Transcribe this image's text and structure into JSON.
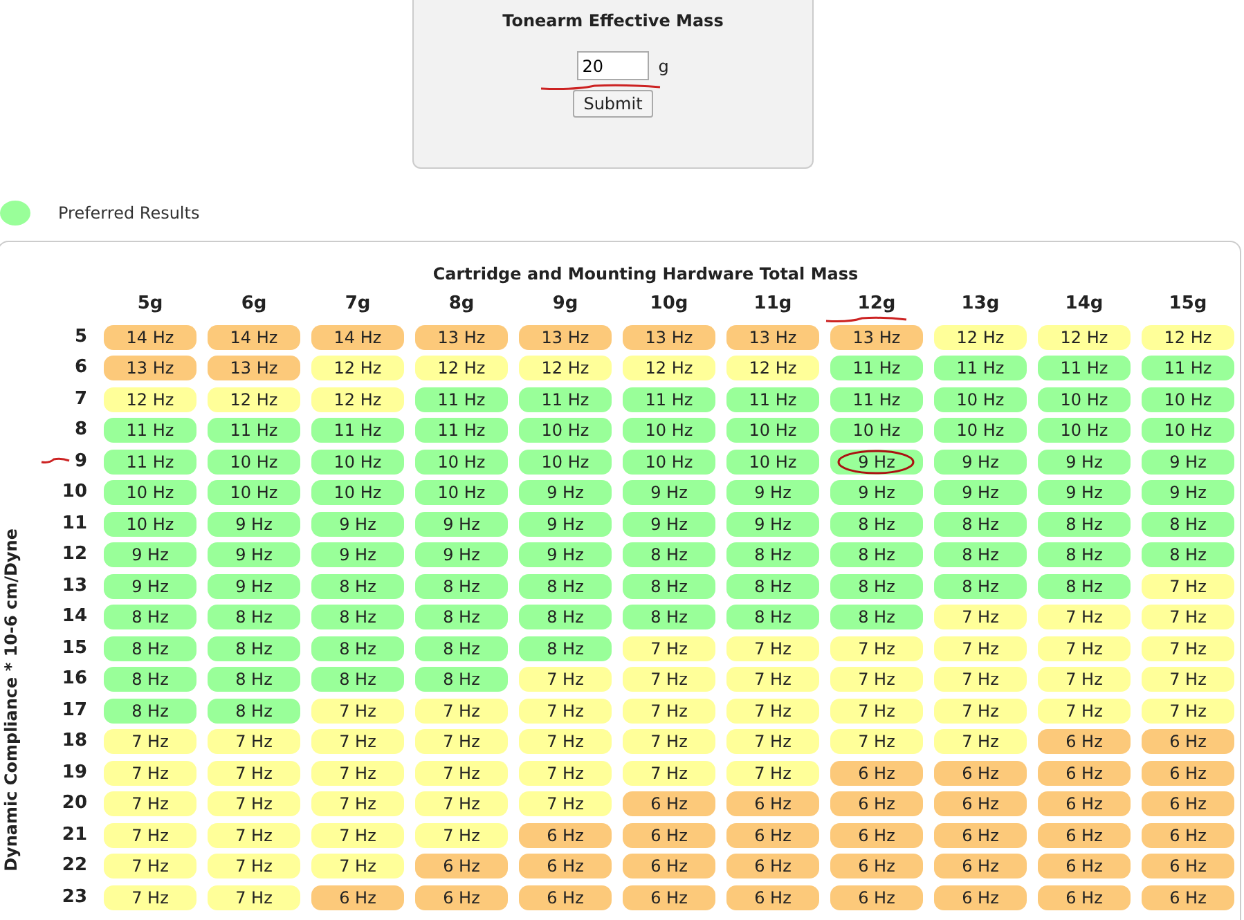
{
  "mass_form": {
    "title": "Tonearm Effective Mass",
    "value": "20",
    "underlined": true,
    "unit": "g",
    "submit": "Submit"
  },
  "legend": {
    "label": "Preferred Results",
    "color": "#99ff99"
  },
  "table": {
    "title": "Cartridge and Mounting Hardware Total Mass",
    "y_axis_label": "Dynamic Compliance * 10-6 cm/Dyne",
    "columns": [
      {
        "label": "5g",
        "underlined": false
      },
      {
        "label": "6g",
        "underlined": false
      },
      {
        "label": "7g",
        "underlined": false
      },
      {
        "label": "8g",
        "underlined": false
      },
      {
        "label": "9g",
        "underlined": false
      },
      {
        "label": "10g",
        "underlined": false
      },
      {
        "label": "11g",
        "underlined": false
      },
      {
        "label": "12g",
        "underlined": true
      },
      {
        "label": "13g",
        "underlined": false
      },
      {
        "label": "14g",
        "underlined": false
      },
      {
        "label": "15g",
        "underlined": false
      }
    ],
    "rows": [
      {
        "label": "5",
        "underlined": false,
        "cells": [
          {
            "text": "14 Hz",
            "color": "#fcc97a",
            "circled": false
          },
          {
            "text": "14 Hz",
            "color": "#fcc97a",
            "circled": false
          },
          {
            "text": "14 Hz",
            "color": "#fcc97a",
            "circled": false
          },
          {
            "text": "13 Hz",
            "color": "#fcc97a",
            "circled": false
          },
          {
            "text": "13 Hz",
            "color": "#fcc97a",
            "circled": false
          },
          {
            "text": "13 Hz",
            "color": "#fcc97a",
            "circled": false
          },
          {
            "text": "13 Hz",
            "color": "#fcc97a",
            "circled": false
          },
          {
            "text": "13 Hz",
            "color": "#fcc97a",
            "circled": false
          },
          {
            "text": "12 Hz",
            "color": "#ffff99",
            "circled": false
          },
          {
            "text": "12 Hz",
            "color": "#ffff99",
            "circled": false
          },
          {
            "text": "12 Hz",
            "color": "#ffff99",
            "circled": false
          }
        ]
      },
      {
        "label": "6",
        "underlined": false,
        "cells": [
          {
            "text": "13 Hz",
            "color": "#fcc97a",
            "circled": false
          },
          {
            "text": "13 Hz",
            "color": "#fcc97a",
            "circled": false
          },
          {
            "text": "12 Hz",
            "color": "#ffff99",
            "circled": false
          },
          {
            "text": "12 Hz",
            "color": "#ffff99",
            "circled": false
          },
          {
            "text": "12 Hz",
            "color": "#ffff99",
            "circled": false
          },
          {
            "text": "12 Hz",
            "color": "#ffff99",
            "circled": false
          },
          {
            "text": "12 Hz",
            "color": "#ffff99",
            "circled": false
          },
          {
            "text": "11 Hz",
            "color": "#99ff99",
            "circled": false
          },
          {
            "text": "11 Hz",
            "color": "#99ff99",
            "circled": false
          },
          {
            "text": "11 Hz",
            "color": "#99ff99",
            "circled": false
          },
          {
            "text": "11 Hz",
            "color": "#99ff99",
            "circled": false
          }
        ]
      },
      {
        "label": "7",
        "underlined": false,
        "cells": [
          {
            "text": "12 Hz",
            "color": "#ffff99",
            "circled": false
          },
          {
            "text": "12 Hz",
            "color": "#ffff99",
            "circled": false
          },
          {
            "text": "12 Hz",
            "color": "#ffff99",
            "circled": false
          },
          {
            "text": "11 Hz",
            "color": "#99ff99",
            "circled": false
          },
          {
            "text": "11 Hz",
            "color": "#99ff99",
            "circled": false
          },
          {
            "text": "11 Hz",
            "color": "#99ff99",
            "circled": false
          },
          {
            "text": "11 Hz",
            "color": "#99ff99",
            "circled": false
          },
          {
            "text": "11 Hz",
            "color": "#99ff99",
            "circled": false
          },
          {
            "text": "10 Hz",
            "color": "#99ff99",
            "circled": false
          },
          {
            "text": "10 Hz",
            "color": "#99ff99",
            "circled": false
          },
          {
            "text": "10 Hz",
            "color": "#99ff99",
            "circled": false
          }
        ]
      },
      {
        "label": "8",
        "underlined": false,
        "cells": [
          {
            "text": "11 Hz",
            "color": "#99ff99",
            "circled": false
          },
          {
            "text": "11 Hz",
            "color": "#99ff99",
            "circled": false
          },
          {
            "text": "11 Hz",
            "color": "#99ff99",
            "circled": false
          },
          {
            "text": "11 Hz",
            "color": "#99ff99",
            "circled": false
          },
          {
            "text": "10 Hz",
            "color": "#99ff99",
            "circled": false
          },
          {
            "text": "10 Hz",
            "color": "#99ff99",
            "circled": false
          },
          {
            "text": "10 Hz",
            "color": "#99ff99",
            "circled": false
          },
          {
            "text": "10 Hz",
            "color": "#99ff99",
            "circled": false
          },
          {
            "text": "10 Hz",
            "color": "#99ff99",
            "circled": false
          },
          {
            "text": "10 Hz",
            "color": "#99ff99",
            "circled": false
          },
          {
            "text": "10 Hz",
            "color": "#99ff99",
            "circled": false
          }
        ]
      },
      {
        "label": "9",
        "underlined": true,
        "cells": [
          {
            "text": "11 Hz",
            "color": "#99ff99",
            "circled": false
          },
          {
            "text": "10 Hz",
            "color": "#99ff99",
            "circled": false
          },
          {
            "text": "10 Hz",
            "color": "#99ff99",
            "circled": false
          },
          {
            "text": "10 Hz",
            "color": "#99ff99",
            "circled": false
          },
          {
            "text": "10 Hz",
            "color": "#99ff99",
            "circled": false
          },
          {
            "text": "10 Hz",
            "color": "#99ff99",
            "circled": false
          },
          {
            "text": "10 Hz",
            "color": "#99ff99",
            "circled": false
          },
          {
            "text": "9 Hz",
            "color": "#99ff99",
            "circled": true
          },
          {
            "text": "9 Hz",
            "color": "#99ff99",
            "circled": false
          },
          {
            "text": "9 Hz",
            "color": "#99ff99",
            "circled": false
          },
          {
            "text": "9 Hz",
            "color": "#99ff99",
            "circled": false
          }
        ]
      },
      {
        "label": "10",
        "underlined": false,
        "cells": [
          {
            "text": "10 Hz",
            "color": "#99ff99",
            "circled": false
          },
          {
            "text": "10 Hz",
            "color": "#99ff99",
            "circled": false
          },
          {
            "text": "10 Hz",
            "color": "#99ff99",
            "circled": false
          },
          {
            "text": "10 Hz",
            "color": "#99ff99",
            "circled": false
          },
          {
            "text": "9 Hz",
            "color": "#99ff99",
            "circled": false
          },
          {
            "text": "9 Hz",
            "color": "#99ff99",
            "circled": false
          },
          {
            "text": "9 Hz",
            "color": "#99ff99",
            "circled": false
          },
          {
            "text": "9 Hz",
            "color": "#99ff99",
            "circled": false
          },
          {
            "text": "9 Hz",
            "color": "#99ff99",
            "circled": false
          },
          {
            "text": "9 Hz",
            "color": "#99ff99",
            "circled": false
          },
          {
            "text": "9 Hz",
            "color": "#99ff99",
            "circled": false
          }
        ]
      },
      {
        "label": "11",
        "underlined": false,
        "cells": [
          {
            "text": "10 Hz",
            "color": "#99ff99",
            "circled": false
          },
          {
            "text": "9 Hz",
            "color": "#99ff99",
            "circled": false
          },
          {
            "text": "9 Hz",
            "color": "#99ff99",
            "circled": false
          },
          {
            "text": "9 Hz",
            "color": "#99ff99",
            "circled": false
          },
          {
            "text": "9 Hz",
            "color": "#99ff99",
            "circled": false
          },
          {
            "text": "9 Hz",
            "color": "#99ff99",
            "circled": false
          },
          {
            "text": "9 Hz",
            "color": "#99ff99",
            "circled": false
          },
          {
            "text": "8 Hz",
            "color": "#99ff99",
            "circled": false
          },
          {
            "text": "8 Hz",
            "color": "#99ff99",
            "circled": false
          },
          {
            "text": "8 Hz",
            "color": "#99ff99",
            "circled": false
          },
          {
            "text": "8 Hz",
            "color": "#99ff99",
            "circled": false
          }
        ]
      },
      {
        "label": "12",
        "underlined": false,
        "cells": [
          {
            "text": "9 Hz",
            "color": "#99ff99",
            "circled": false
          },
          {
            "text": "9 Hz",
            "color": "#99ff99",
            "circled": false
          },
          {
            "text": "9 Hz",
            "color": "#99ff99",
            "circled": false
          },
          {
            "text": "9 Hz",
            "color": "#99ff99",
            "circled": false
          },
          {
            "text": "9 Hz",
            "color": "#99ff99",
            "circled": false
          },
          {
            "text": "8 Hz",
            "color": "#99ff99",
            "circled": false
          },
          {
            "text": "8 Hz",
            "color": "#99ff99",
            "circled": false
          },
          {
            "text": "8 Hz",
            "color": "#99ff99",
            "circled": false
          },
          {
            "text": "8 Hz",
            "color": "#99ff99",
            "circled": false
          },
          {
            "text": "8 Hz",
            "color": "#99ff99",
            "circled": false
          },
          {
            "text": "8 Hz",
            "color": "#99ff99",
            "circled": false
          }
        ]
      },
      {
        "label": "13",
        "underlined": false,
        "cells": [
          {
            "text": "9 Hz",
            "color": "#99ff99",
            "circled": false
          },
          {
            "text": "9 Hz",
            "color": "#99ff99",
            "circled": false
          },
          {
            "text": "8 Hz",
            "color": "#99ff99",
            "circled": false
          },
          {
            "text": "8 Hz",
            "color": "#99ff99",
            "circled": false
          },
          {
            "text": "8 Hz",
            "color": "#99ff99",
            "circled": false
          },
          {
            "text": "8 Hz",
            "color": "#99ff99",
            "circled": false
          },
          {
            "text": "8 Hz",
            "color": "#99ff99",
            "circled": false
          },
          {
            "text": "8 Hz",
            "color": "#99ff99",
            "circled": false
          },
          {
            "text": "8 Hz",
            "color": "#99ff99",
            "circled": false
          },
          {
            "text": "8 Hz",
            "color": "#99ff99",
            "circled": false
          },
          {
            "text": "7 Hz",
            "color": "#ffff99",
            "circled": false
          }
        ]
      },
      {
        "label": "14",
        "underlined": false,
        "cells": [
          {
            "text": "8 Hz",
            "color": "#99ff99",
            "circled": false
          },
          {
            "text": "8 Hz",
            "color": "#99ff99",
            "circled": false
          },
          {
            "text": "8 Hz",
            "color": "#99ff99",
            "circled": false
          },
          {
            "text": "8 Hz",
            "color": "#99ff99",
            "circled": false
          },
          {
            "text": "8 Hz",
            "color": "#99ff99",
            "circled": false
          },
          {
            "text": "8 Hz",
            "color": "#99ff99",
            "circled": false
          },
          {
            "text": "8 Hz",
            "color": "#99ff99",
            "circled": false
          },
          {
            "text": "8 Hz",
            "color": "#99ff99",
            "circled": false
          },
          {
            "text": "7 Hz",
            "color": "#ffff99",
            "circled": false
          },
          {
            "text": "7 Hz",
            "color": "#ffff99",
            "circled": false
          },
          {
            "text": "7 Hz",
            "color": "#ffff99",
            "circled": false
          }
        ]
      },
      {
        "label": "15",
        "underlined": false,
        "cells": [
          {
            "text": "8 Hz",
            "color": "#99ff99",
            "circled": false
          },
          {
            "text": "8 Hz",
            "color": "#99ff99",
            "circled": false
          },
          {
            "text": "8 Hz",
            "color": "#99ff99",
            "circled": false
          },
          {
            "text": "8 Hz",
            "color": "#99ff99",
            "circled": false
          },
          {
            "text": "8 Hz",
            "color": "#99ff99",
            "circled": false
          },
          {
            "text": "7 Hz",
            "color": "#ffff99",
            "circled": false
          },
          {
            "text": "7 Hz",
            "color": "#ffff99",
            "circled": false
          },
          {
            "text": "7 Hz",
            "color": "#ffff99",
            "circled": false
          },
          {
            "text": "7 Hz",
            "color": "#ffff99",
            "circled": false
          },
          {
            "text": "7 Hz",
            "color": "#ffff99",
            "circled": false
          },
          {
            "text": "7 Hz",
            "color": "#ffff99",
            "circled": false
          }
        ]
      },
      {
        "label": "16",
        "underlined": false,
        "cells": [
          {
            "text": "8 Hz",
            "color": "#99ff99",
            "circled": false
          },
          {
            "text": "8 Hz",
            "color": "#99ff99",
            "circled": false
          },
          {
            "text": "8 Hz",
            "color": "#99ff99",
            "circled": false
          },
          {
            "text": "8 Hz",
            "color": "#99ff99",
            "circled": false
          },
          {
            "text": "7 Hz",
            "color": "#ffff99",
            "circled": false
          },
          {
            "text": "7 Hz",
            "color": "#ffff99",
            "circled": false
          },
          {
            "text": "7 Hz",
            "color": "#ffff99",
            "circled": false
          },
          {
            "text": "7 Hz",
            "color": "#ffff99",
            "circled": false
          },
          {
            "text": "7 Hz",
            "color": "#ffff99",
            "circled": false
          },
          {
            "text": "7 Hz",
            "color": "#ffff99",
            "circled": false
          },
          {
            "text": "7 Hz",
            "color": "#ffff99",
            "circled": false
          }
        ]
      },
      {
        "label": "17",
        "underlined": false,
        "cells": [
          {
            "text": "8 Hz",
            "color": "#99ff99",
            "circled": false
          },
          {
            "text": "8 Hz",
            "color": "#99ff99",
            "circled": false
          },
          {
            "text": "7 Hz",
            "color": "#ffff99",
            "circled": false
          },
          {
            "text": "7 Hz",
            "color": "#ffff99",
            "circled": false
          },
          {
            "text": "7 Hz",
            "color": "#ffff99",
            "circled": false
          },
          {
            "text": "7 Hz",
            "color": "#ffff99",
            "circled": false
          },
          {
            "text": "7 Hz",
            "color": "#ffff99",
            "circled": false
          },
          {
            "text": "7 Hz",
            "color": "#ffff99",
            "circled": false
          },
          {
            "text": "7 Hz",
            "color": "#ffff99",
            "circled": false
          },
          {
            "text": "7 Hz",
            "color": "#ffff99",
            "circled": false
          },
          {
            "text": "7 Hz",
            "color": "#ffff99",
            "circled": false
          }
        ]
      },
      {
        "label": "18",
        "underlined": false,
        "cells": [
          {
            "text": "7 Hz",
            "color": "#ffff99",
            "circled": false
          },
          {
            "text": "7 Hz",
            "color": "#ffff99",
            "circled": false
          },
          {
            "text": "7 Hz",
            "color": "#ffff99",
            "circled": false
          },
          {
            "text": "7 Hz",
            "color": "#ffff99",
            "circled": false
          },
          {
            "text": "7 Hz",
            "color": "#ffff99",
            "circled": false
          },
          {
            "text": "7 Hz",
            "color": "#ffff99",
            "circled": false
          },
          {
            "text": "7 Hz",
            "color": "#ffff99",
            "circled": false
          },
          {
            "text": "7 Hz",
            "color": "#ffff99",
            "circled": false
          },
          {
            "text": "7 Hz",
            "color": "#ffff99",
            "circled": false
          },
          {
            "text": "6 Hz",
            "color": "#fcc97a",
            "circled": false
          },
          {
            "text": "6 Hz",
            "color": "#fcc97a",
            "circled": false
          }
        ]
      },
      {
        "label": "19",
        "underlined": false,
        "cells": [
          {
            "text": "7 Hz",
            "color": "#ffff99",
            "circled": false
          },
          {
            "text": "7 Hz",
            "color": "#ffff99",
            "circled": false
          },
          {
            "text": "7 Hz",
            "color": "#ffff99",
            "circled": false
          },
          {
            "text": "7 Hz",
            "color": "#ffff99",
            "circled": false
          },
          {
            "text": "7 Hz",
            "color": "#ffff99",
            "circled": false
          },
          {
            "text": "7 Hz",
            "color": "#ffff99",
            "circled": false
          },
          {
            "text": "7 Hz",
            "color": "#ffff99",
            "circled": false
          },
          {
            "text": "6 Hz",
            "color": "#fcc97a",
            "circled": false
          },
          {
            "text": "6 Hz",
            "color": "#fcc97a",
            "circled": false
          },
          {
            "text": "6 Hz",
            "color": "#fcc97a",
            "circled": false
          },
          {
            "text": "6 Hz",
            "color": "#fcc97a",
            "circled": false
          }
        ]
      },
      {
        "label": "20",
        "underlined": false,
        "cells": [
          {
            "text": "7 Hz",
            "color": "#ffff99",
            "circled": false
          },
          {
            "text": "7 Hz",
            "color": "#ffff99",
            "circled": false
          },
          {
            "text": "7 Hz",
            "color": "#ffff99",
            "circled": false
          },
          {
            "text": "7 Hz",
            "color": "#ffff99",
            "circled": false
          },
          {
            "text": "7 Hz",
            "color": "#ffff99",
            "circled": false
          },
          {
            "text": "6 Hz",
            "color": "#fcc97a",
            "circled": false
          },
          {
            "text": "6 Hz",
            "color": "#fcc97a",
            "circled": false
          },
          {
            "text": "6 Hz",
            "color": "#fcc97a",
            "circled": false
          },
          {
            "text": "6 Hz",
            "color": "#fcc97a",
            "circled": false
          },
          {
            "text": "6 Hz",
            "color": "#fcc97a",
            "circled": false
          },
          {
            "text": "6 Hz",
            "color": "#fcc97a",
            "circled": false
          }
        ]
      },
      {
        "label": "21",
        "underlined": false,
        "cells": [
          {
            "text": "7 Hz",
            "color": "#ffff99",
            "circled": false
          },
          {
            "text": "7 Hz",
            "color": "#ffff99",
            "circled": false
          },
          {
            "text": "7 Hz",
            "color": "#ffff99",
            "circled": false
          },
          {
            "text": "7 Hz",
            "color": "#ffff99",
            "circled": false
          },
          {
            "text": "6 Hz",
            "color": "#fcc97a",
            "circled": false
          },
          {
            "text": "6 Hz",
            "color": "#fcc97a",
            "circled": false
          },
          {
            "text": "6 Hz",
            "color": "#fcc97a",
            "circled": false
          },
          {
            "text": "6 Hz",
            "color": "#fcc97a",
            "circled": false
          },
          {
            "text": "6 Hz",
            "color": "#fcc97a",
            "circled": false
          },
          {
            "text": "6 Hz",
            "color": "#fcc97a",
            "circled": false
          },
          {
            "text": "6 Hz",
            "color": "#fcc97a",
            "circled": false
          }
        ]
      },
      {
        "label": "22",
        "underlined": false,
        "cells": [
          {
            "text": "7 Hz",
            "color": "#ffff99",
            "circled": false
          },
          {
            "text": "7 Hz",
            "color": "#ffff99",
            "circled": false
          },
          {
            "text": "7 Hz",
            "color": "#ffff99",
            "circled": false
          },
          {
            "text": "6 Hz",
            "color": "#fcc97a",
            "circled": false
          },
          {
            "text": "6 Hz",
            "color": "#fcc97a",
            "circled": false
          },
          {
            "text": "6 Hz",
            "color": "#fcc97a",
            "circled": false
          },
          {
            "text": "6 Hz",
            "color": "#fcc97a",
            "circled": false
          },
          {
            "text": "6 Hz",
            "color": "#fcc97a",
            "circled": false
          },
          {
            "text": "6 Hz",
            "color": "#fcc97a",
            "circled": false
          },
          {
            "text": "6 Hz",
            "color": "#fcc97a",
            "circled": false
          },
          {
            "text": "6 Hz",
            "color": "#fcc97a",
            "circled": false
          }
        ]
      },
      {
        "label": "23",
        "underlined": false,
        "cells": [
          {
            "text": "7 Hz",
            "color": "#ffff99",
            "circled": false
          },
          {
            "text": "7 Hz",
            "color": "#ffff99",
            "circled": false
          },
          {
            "text": "6 Hz",
            "color": "#fcc97a",
            "circled": false
          },
          {
            "text": "6 Hz",
            "color": "#fcc97a",
            "circled": false
          },
          {
            "text": "6 Hz",
            "color": "#fcc97a",
            "circled": false
          },
          {
            "text": "6 Hz",
            "color": "#fcc97a",
            "circled": false
          },
          {
            "text": "6 Hz",
            "color": "#fcc97a",
            "circled": false
          },
          {
            "text": "6 Hz",
            "color": "#fcc97a",
            "circled": false
          },
          {
            "text": "6 Hz",
            "color": "#fcc97a",
            "circled": false
          },
          {
            "text": "6 Hz",
            "color": "#fcc97a",
            "circled": false
          },
          {
            "text": "6 Hz",
            "color": "#fcc97a",
            "circled": false
          }
        ]
      }
    ]
  }
}
